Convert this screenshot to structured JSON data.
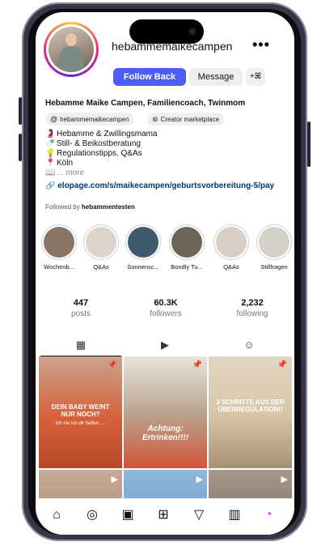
{
  "profile": {
    "username": "hebammemaikecampen",
    "more_label": "•••",
    "full_name": "Hebamme Maike Campen, Familiencoach, Twinmom",
    "buttons": {
      "follow_back": "Follow Back",
      "message": "Message",
      "add_user": "+ꕤ"
    },
    "chips": [
      {
        "icon": "threads-icon",
        "glyph": "@",
        "label": "hebammemaikecampen"
      },
      {
        "icon": "creator-marketplace-icon",
        "glyph": "⊛",
        "label": "Creator marketplace"
      }
    ],
    "bio": [
      {
        "emoji": "🤰",
        "text": "Hebamme & Zwillingsmama"
      },
      {
        "emoji": "🍼",
        "text": "Still- & Beikostberatung"
      },
      {
        "emoji": "💡",
        "text": "Regulationstipps, Q&As"
      },
      {
        "emoji": "📍",
        "text": "Köln"
      },
      {
        "emoji": "📖",
        "text": "... more"
      }
    ],
    "link": "elopage.com/s/maikecampen/geburtsvorbereitung-5/pay",
    "link_icon": "🔗",
    "followed_by_prefix": "Followed by ",
    "followed_by_user": "hebammentesten"
  },
  "highlights": [
    {
      "label": "Wochenb...",
      "color": "#8a7565"
    },
    {
      "label": "Q&As",
      "color": "#dcd3cb"
    },
    {
      "label": "Sonnensc...",
      "color": "#3d5a6e"
    },
    {
      "label": "Bondly Tu...",
      "color": "#6d6658"
    },
    {
      "label": "Q&As",
      "color": "#d8cec6"
    },
    {
      "label": "Stillfragen",
      "color": "#d6d0ca"
    }
  ],
  "stats": {
    "posts": {
      "value": "447",
      "label": "posts"
    },
    "followers": {
      "value": "60.3K",
      "label": "followers"
    },
    "following": {
      "value": "2,232",
      "label": "following"
    }
  },
  "tabs": [
    {
      "icon": "grid-icon",
      "glyph": "▦"
    },
    {
      "icon": "reels-icon",
      "glyph": "▶"
    },
    {
      "icon": "tagged-icon",
      "glyph": "☺"
    }
  ],
  "posts": [
    {
      "text": "DEIN BABY WEINT NUR NOCH?",
      "sub": "Ich nie ich dir helfen, ...",
      "color": "#d7603a"
    },
    {
      "text": "Achtung: Ertrinken!!!!",
      "color": "#b9a58e"
    },
    {
      "text": "3 SCHRITTE AUS DER ÜBERREGULATION!!",
      "color": "#d8c7a9"
    },
    {
      "text": "",
      "color": "#b89b84"
    },
    {
      "text": "",
      "color": "#7fa9cf"
    },
    {
      "text": "",
      "color": "#8f8477"
    }
  ],
  "nav": [
    {
      "icon": "home-icon",
      "glyph": "⌂"
    },
    {
      "icon": "explore-icon",
      "glyph": "◎"
    },
    {
      "icon": "reels-icon",
      "glyph": "▣"
    },
    {
      "icon": "create-icon",
      "glyph": "⊞"
    },
    {
      "icon": "send-icon",
      "glyph": "▽"
    },
    {
      "icon": "insights-icon",
      "glyph": "▥"
    },
    {
      "icon": "profile-avatar-icon",
      "glyph": "◔"
    }
  ],
  "colors": {
    "accent": "#4d5df7",
    "link": "#00376b",
    "frame": "#3a3447"
  }
}
